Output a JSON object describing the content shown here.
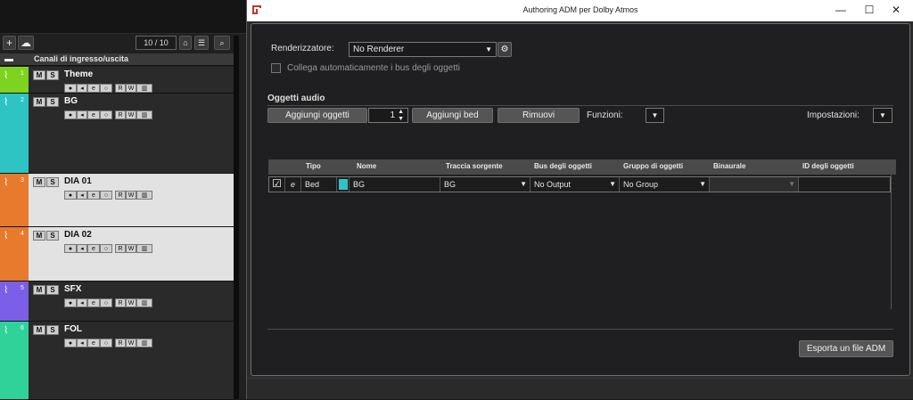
{
  "daw": {
    "counter": "10 / 10",
    "folder_header": "Canali di ingresso/uscita",
    "ms_m": "M",
    "ms_s": "S",
    "ctrl_labels": [
      "●",
      "◂",
      "e",
      "○",
      "R",
      "W",
      "▥"
    ],
    "tracks": [
      {
        "num": "1",
        "name": "Theme",
        "color": "#7ed321",
        "selected": false
      },
      {
        "num": "2",
        "name": "BG",
        "color": "#2ec4c4",
        "selected": false
      },
      {
        "num": "3",
        "name": "DIA 01",
        "color": "#e87a2e",
        "selected": true
      },
      {
        "num": "4",
        "name": "DIA 02",
        "color": "#e87a2e",
        "selected": true
      },
      {
        "num": "5",
        "name": "SFX",
        "color": "#7b5fe8",
        "selected": false
      },
      {
        "num": "6",
        "name": "FOL",
        "color": "#2fd39a",
        "selected": false
      }
    ]
  },
  "dialog": {
    "title": "Authoring ADM per Dolby Atmos",
    "renderer_label": "Renderizzatore:",
    "renderer_value": "No Renderer",
    "auto_connect_label": "Collega automaticamente i bus degli oggetti",
    "section_title": "Oggetti audio",
    "add_objects_label": "Aggiungi oggetti",
    "add_objects_count": "1",
    "add_bed_label": "Aggiungi bed",
    "remove_label": "Rimuovi",
    "functions_label": "Funzioni:",
    "settings_label": "Impostazioni:",
    "columns": [
      "Tipo",
      "Nome",
      "Traccia sorgente",
      "Bus degli oggetti",
      "Gruppo di oggetti",
      "Binaurale",
      "ID degli oggetti"
    ],
    "row": {
      "type": "Bed",
      "name": "BG",
      "source": "BG",
      "bus": "No Output",
      "group": "No Group",
      "binaural": "",
      "id": "",
      "swatch_color": "#2ec4c4"
    },
    "export_label": "Esporta un file ADM"
  }
}
